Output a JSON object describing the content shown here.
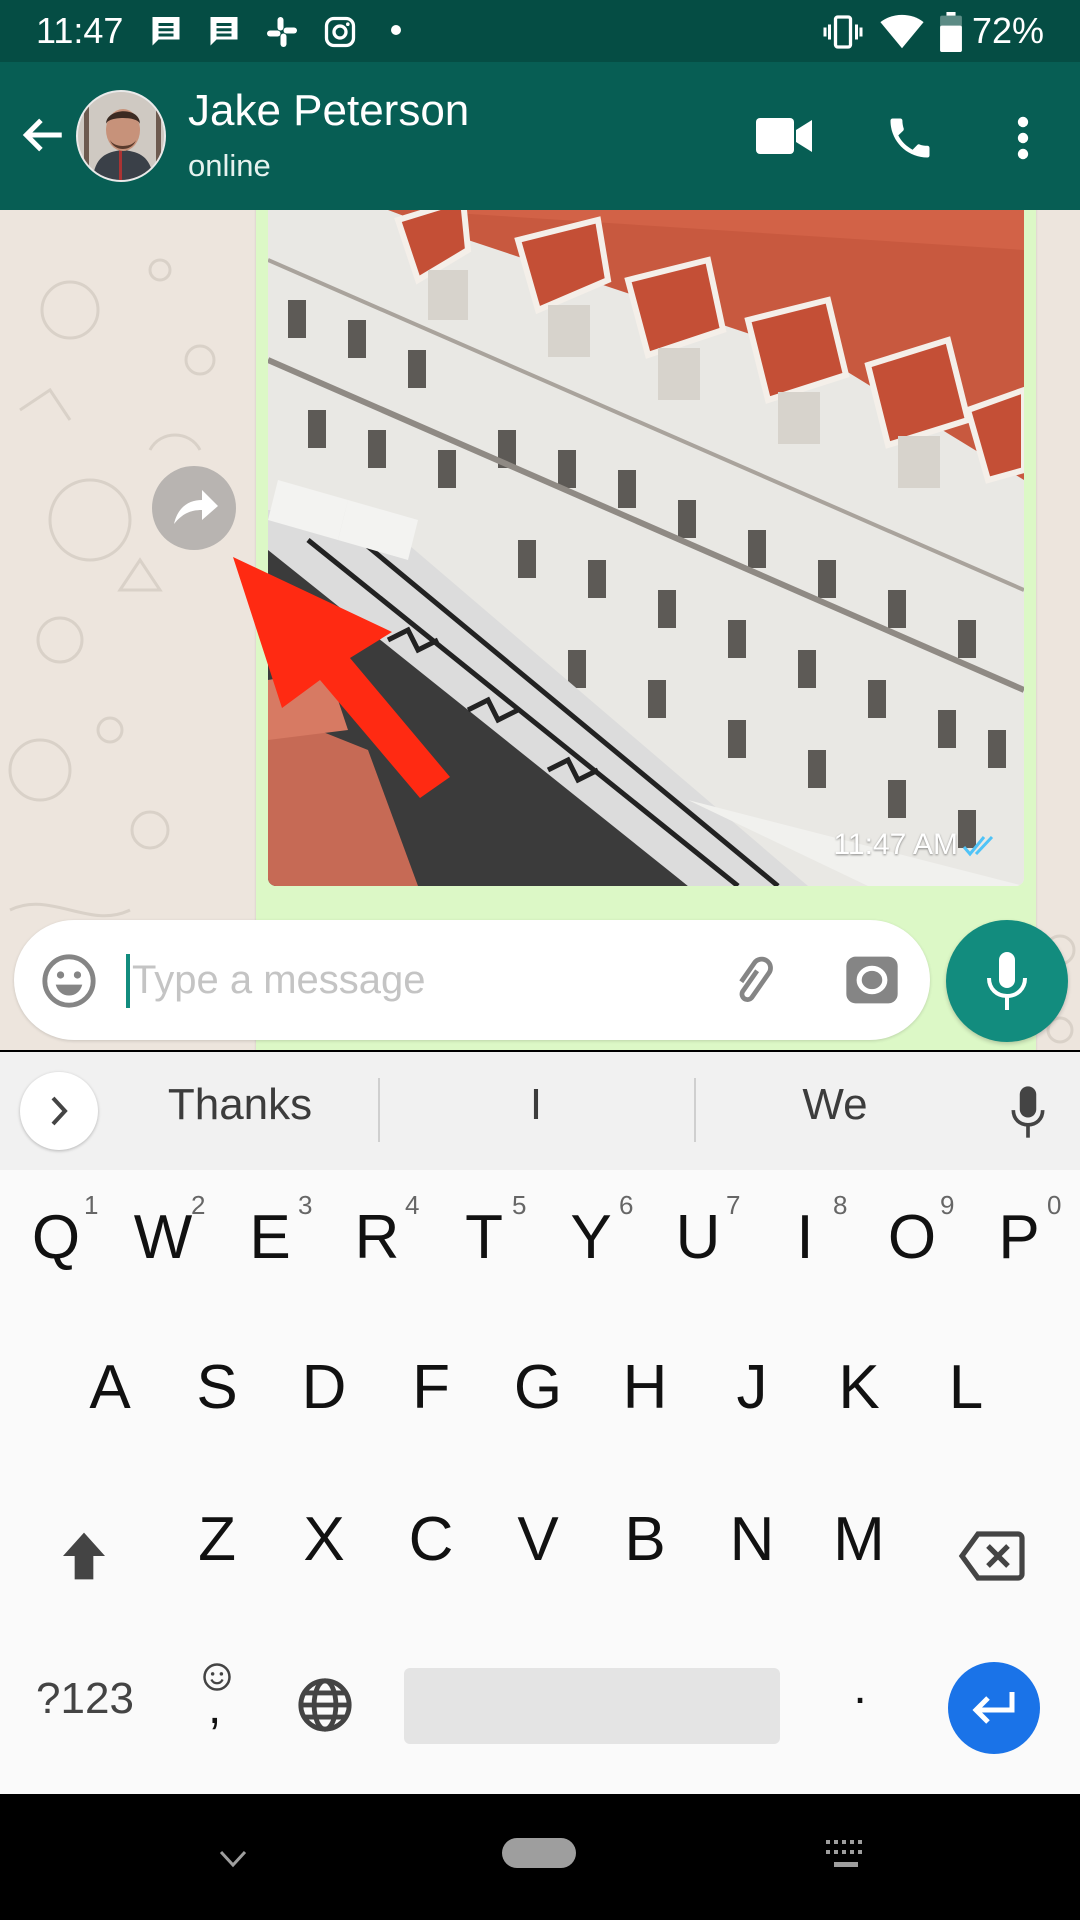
{
  "status_bar": {
    "time": "11:47",
    "notification_icons": [
      "message-icon",
      "message-icon",
      "slack-icon",
      "instagram-icon",
      "dot-icon"
    ],
    "system_icons": [
      "vibrate-icon",
      "wifi-icon",
      "battery-icon"
    ],
    "battery_percent": "72%"
  },
  "header": {
    "contact_name": "Jake Peterson",
    "contact_status": "online",
    "actions": [
      "video-call-icon",
      "voice-call-icon",
      "more-options-icon"
    ]
  },
  "message": {
    "type": "image",
    "description": "Aerial photo of white building with red tiled roof and patterned sidewalk",
    "time": "11:47 AM",
    "status": "read",
    "tick_color": "#4fc3f7"
  },
  "annotation": {
    "arrow_color": "#ff2a12",
    "points_to": "forward-button"
  },
  "composer": {
    "placeholder": "Type a message",
    "value": ""
  },
  "keyboard": {
    "suggestions": [
      "Thanks",
      "I",
      "We"
    ],
    "row1": [
      {
        "key": "Q",
        "hint": "1"
      },
      {
        "key": "W",
        "hint": "2"
      },
      {
        "key": "E",
        "hint": "3"
      },
      {
        "key": "R",
        "hint": "4"
      },
      {
        "key": "T",
        "hint": "5"
      },
      {
        "key": "Y",
        "hint": "6"
      },
      {
        "key": "U",
        "hint": "7"
      },
      {
        "key": "I",
        "hint": "8"
      },
      {
        "key": "O",
        "hint": "9"
      },
      {
        "key": "P",
        "hint": "0"
      }
    ],
    "row2": [
      "A",
      "S",
      "D",
      "F",
      "G",
      "H",
      "J",
      "K",
      "L"
    ],
    "row3": [
      "Z",
      "X",
      "C",
      "V",
      "B",
      "N",
      "M"
    ],
    "symbols_label": "?123",
    "comma_label": ",",
    "period_label": "."
  },
  "colors": {
    "status_bar": "#054d44",
    "app_bar": "#075e54",
    "accent": "#128c7e",
    "bubble": "#dcf8c6",
    "enter_key": "#1a73e8"
  }
}
